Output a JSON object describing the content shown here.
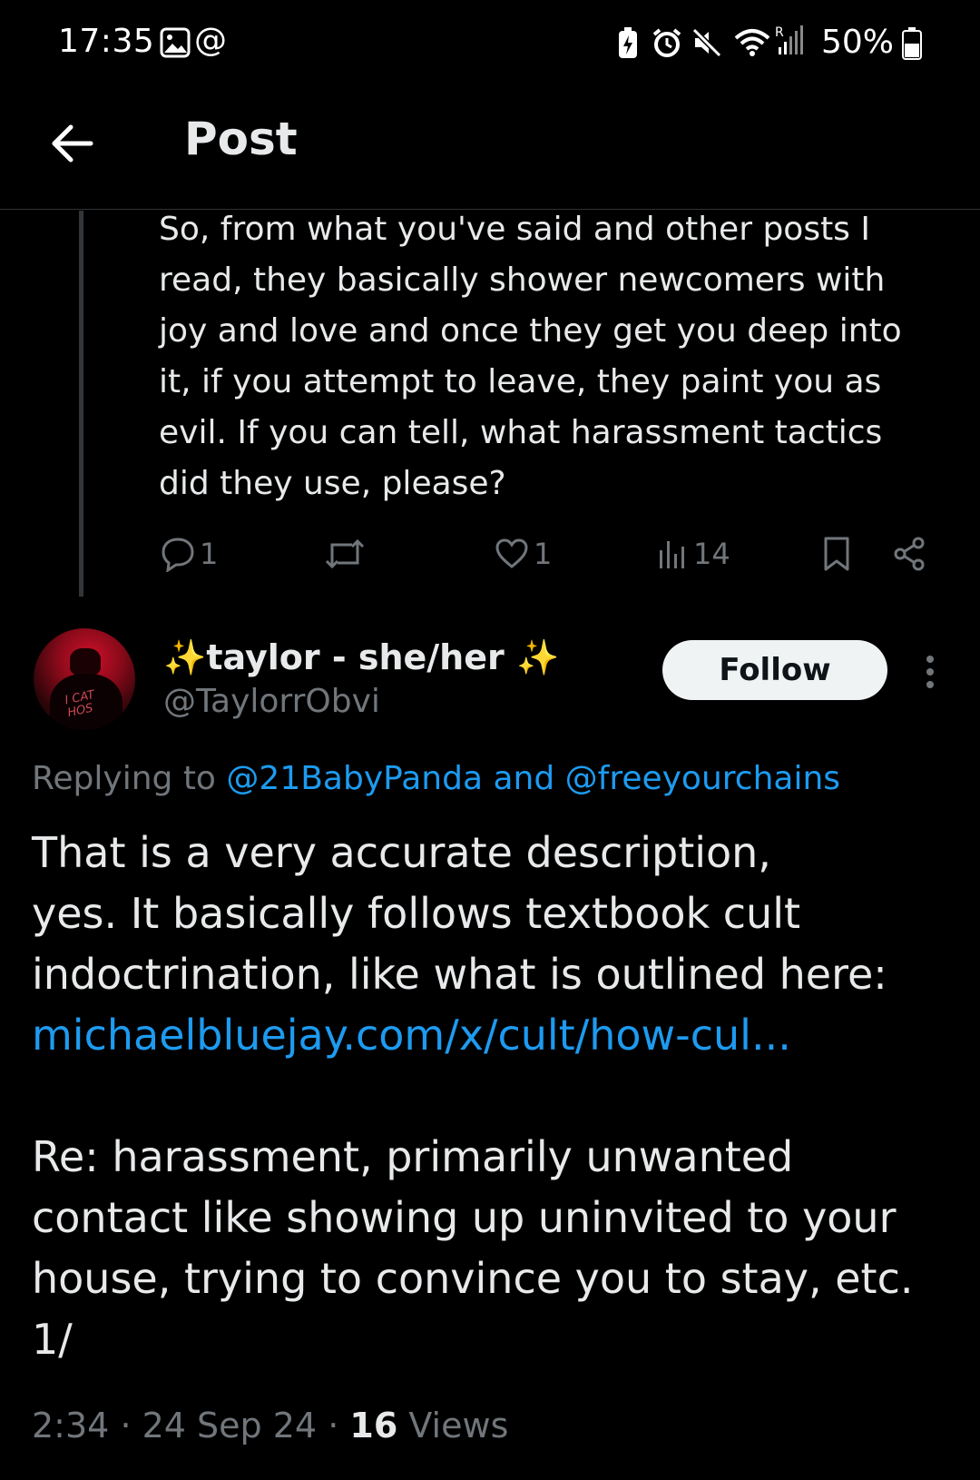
{
  "status_bar": {
    "time": "17:35",
    "left_icons": [
      "gallery-icon",
      "at-sign-icon"
    ],
    "right_icons": [
      "battery-saver-icon",
      "alarm-icon",
      "mute-icon",
      "wifi-icon",
      "signal-icon"
    ],
    "battery": "50%"
  },
  "header": {
    "title": "Post"
  },
  "parent_post": {
    "text": "So, from what you've said and other posts I\nread, they basically shower newcomers with\njoy and love and once they get you deep into\nit, if you attempt to leave, they paint you as\nevil. If you can tell, what harassment tactics\ndid they use, please?",
    "replies": "1",
    "likes": "1",
    "views": "14"
  },
  "reply_post": {
    "display_name": "✨taylor - she/her ✨",
    "username": "@TaylorrObvi",
    "follow_label": "Follow",
    "replying_prefix": "Replying to",
    "replying_mentions": "@21BabyPanda and @freeyourchains",
    "text_line1": "That is a very accurate description,",
    "text_line2": "yes. It basically follows textbook cult",
    "text_line3": "indoctrination, like what is outlined here:",
    "link": "michaelbluejay.com/x/cult/how-cul...",
    "text_line4": "Re: harassment, primarily unwanted",
    "text_line5": "contact like showing up uninvited to your",
    "text_line6": "house, trying to convince you to stay, etc.",
    "text_line7": "1/",
    "time": "2:34",
    "date": "24 Sep 24",
    "views_count": "16",
    "views_label": "Views"
  },
  "colors": {
    "background": "#000000",
    "text": "#e7e9ea",
    "secondary_text": "#71767b",
    "link": "#1d9bf0",
    "follow_button_bg": "#eff3f4"
  }
}
